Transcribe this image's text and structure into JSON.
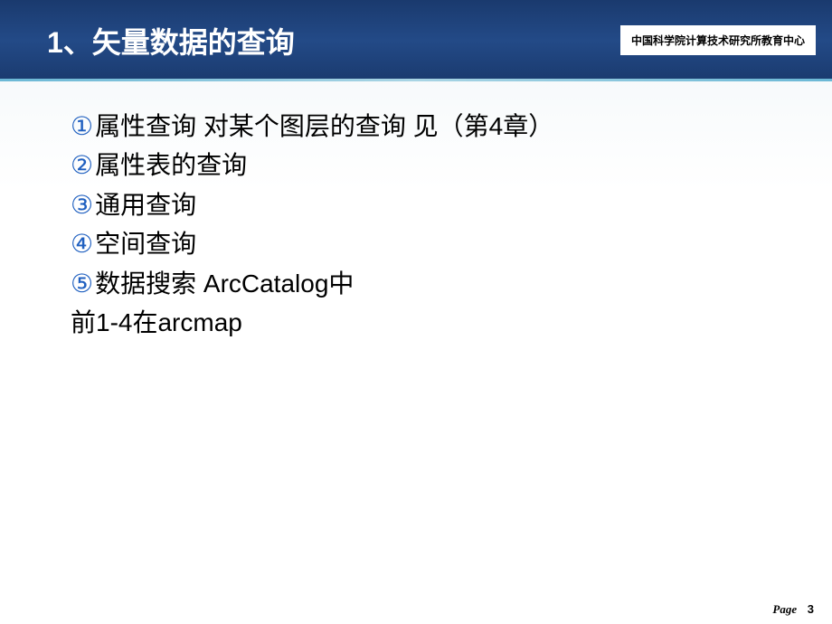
{
  "header": {
    "title": "1、矢量数据的查询",
    "org_label": "中国科学院计算技术研究所教育中心"
  },
  "content": {
    "items": [
      {
        "num": "①",
        "text": "属性查询 对某个图层的查询 见（第4章）"
      },
      {
        "num": "②",
        "text": "属性表的查询"
      },
      {
        "num": "③",
        "text": "通用查询"
      },
      {
        "num": "④",
        "text": "空间查询"
      },
      {
        "num": "⑤",
        "text": "数据搜索 ArcCatalog中"
      }
    ],
    "note": "前1-4在arcmap"
  },
  "footer": {
    "page_label": "Page",
    "page_number": "3"
  }
}
